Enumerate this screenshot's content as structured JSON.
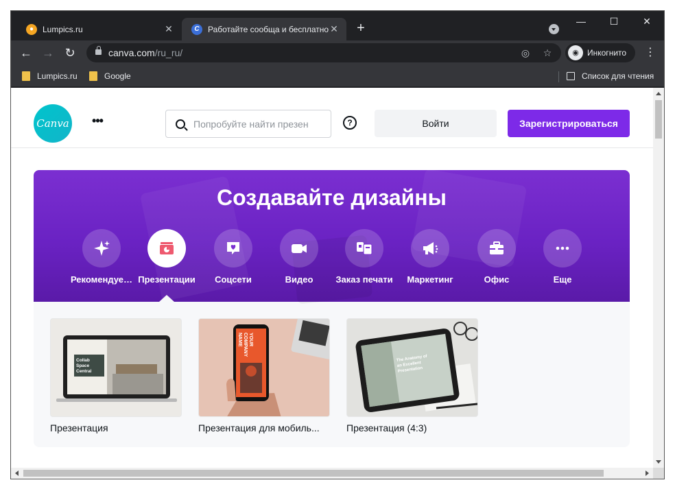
{
  "browser": {
    "tabs": [
      {
        "title": "Lumpics.ru",
        "active": false
      },
      {
        "title": "Работайте сообща и бесплатно",
        "active": true
      }
    ],
    "new_tab": "+",
    "window": {
      "minimize": "—",
      "maximize": "☐",
      "close": "✕"
    },
    "url_host": "canva.com",
    "url_path": "/ru_ru/",
    "incognito_label": "Инкогнито",
    "bookmarks": [
      "Lumpics.ru",
      "Google"
    ],
    "reading_list": "Список для чтения"
  },
  "canva": {
    "logo_text": "Canva",
    "search_placeholder": "Попробуйте найти презен",
    "help": "?",
    "login": "Войти",
    "register": "Зарегистрироваться",
    "hero_title": "Создавайте дизайны",
    "categories": [
      {
        "label": "Рекомендуе…",
        "icon": "sparkle-icon",
        "active": false
      },
      {
        "label": "Презентации",
        "icon": "presentation-icon",
        "active": true
      },
      {
        "label": "Соцсети",
        "icon": "heart-chat-icon",
        "active": false
      },
      {
        "label": "Видео",
        "icon": "video-icon",
        "active": false
      },
      {
        "label": "Заказ печати",
        "icon": "print-icon",
        "active": false
      },
      {
        "label": "Маркетинг",
        "icon": "megaphone-icon",
        "active": false
      },
      {
        "label": "Офис",
        "icon": "briefcase-icon",
        "active": false
      },
      {
        "label": "Еще",
        "icon": "more-icon",
        "active": false
      }
    ],
    "templates": [
      {
        "name": "Презентация",
        "thumb_text": "Collab Space Central"
      },
      {
        "name": "Презентация для мобиль...",
        "thumb_text": "YOUR COMPANY NAME"
      },
      {
        "name": "Презентация (4:3)",
        "thumb_text": "The Anatomy of an Excellent Presentation"
      }
    ]
  },
  "colors": {
    "brand_purple": "#7d2ae8",
    "canva_teal": "#00c4cc",
    "chrome_dark": "#202124"
  }
}
